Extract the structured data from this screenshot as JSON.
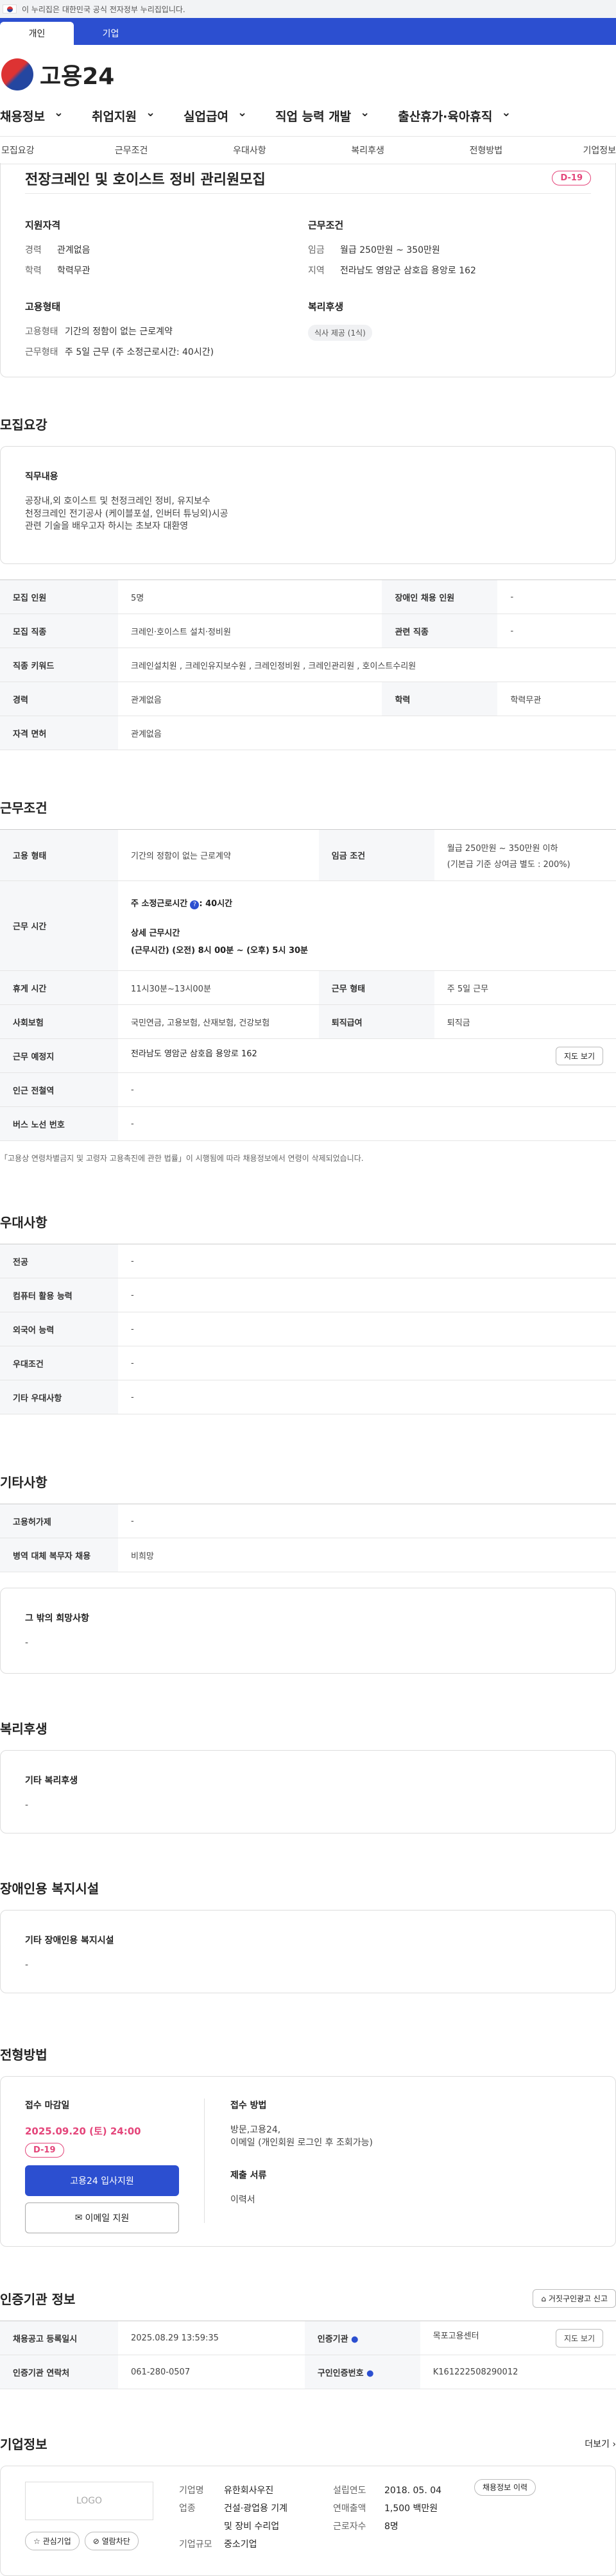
{
  "topbar": {
    "notice": "이 누리집은 대한민국 공식 전자정부 누리집입니다."
  },
  "tabs": [
    "개인",
    "기업"
  ],
  "brand": "고용24",
  "gnb": [
    "채용정보",
    "취업지원",
    "실업급여",
    "직업 능력 개발",
    "출산휴가·육아휴직"
  ],
  "subnav": [
    "모집요강",
    "근무조건",
    "우대사항",
    "복리후생",
    "전형방법",
    "기업정보"
  ],
  "job": {
    "title": "전장크레인 및 호이스트 정비 관리원모집",
    "dday": "D-19",
    "qual_title": "지원자격",
    "career_k": "경력",
    "career_v": "관계없음",
    "edu_k": "학력",
    "edu_v": "학력무관",
    "work_title": "근무조건",
    "wage_k": "임금",
    "wage_v": "월급 250만원 ~ 350만원",
    "loc_k": "지역",
    "loc_v": "전라남도 영암군 삼호읍 용앙로 162",
    "emp_title": "고용형태",
    "emp_k": "고용형태",
    "emp_v": "기간의 정함이 없는 근로계약",
    "type_k": "근무형태",
    "type_v": "주 5일 근무 (주 소정근로시간: 40시간)",
    "wel_title": "복리후생",
    "wel_chip": "식사 제공 (1식)"
  },
  "recruit": {
    "title": "모집요강",
    "duty_h": "직무내용",
    "duty_1": "공장내,외 호이스트 및 천정크레인 정비, 유지보수",
    "duty_2": "천정크레인 전기공사 (케이블포설, 인버터 튜닝외)시공",
    "duty_3": "관련 기술을 배우고자 하시는 초보자 대환영",
    "rows": [
      [
        "모집 인원",
        "5명",
        "장애인 채용 인원",
        "-"
      ],
      [
        "모집 직종",
        "크레인·호이스트 설치·정비원",
        "관련 직종",
        "-"
      ],
      [
        "직종 키워드",
        "크레인설치원 , 크레인유지보수원 , 크레인정비원 , 크레인관리원 , 호이스트수리원",
        "",
        ""
      ],
      [
        "경력",
        "관계없음",
        "학력",
        "학력무관"
      ],
      [
        "자격 면허",
        "관계없음",
        "",
        ""
      ]
    ]
  },
  "cond": {
    "title": "근무조건",
    "emp_h": "고용 형태",
    "emp_v": "기간의 정함이 없는 근로계약",
    "wage_h": "임금 조건",
    "wage_v1": "월급 250만원 ~ 350만원 이하",
    "wage_v2": "(기본급 기준 상여금 별도 : 200%)",
    "time_h": "근무 시간",
    "time_1": "주 소정근로시간",
    "time_1b": ": 40시간",
    "time_2": "상세 근무시간",
    "time_3": "(근무시간) (오전) 8시 00분 ~ (오후) 5시 30분",
    "rest_h": "휴게 시간",
    "rest_v": "11시30분~13시00분",
    "type_h": "근무 형태",
    "type_v": "주 5일 근무",
    "ins_h": "사회보험",
    "ins_v": "국민연금, 고용보험, 산재보험, 건강보험",
    "ret_h": "퇴직급여",
    "ret_v": "퇴직금",
    "loc_h": "근무 예정지",
    "loc_v": "전라남도 영암군 삼호읍 용앙로 162",
    "map_btn": "지도 보기",
    "sub_h": "인근 전철역",
    "sub_v": "-",
    "bus_h": "버스 노선 번호",
    "bus_v": "-",
    "note": "「고용상 연령차별금지 및 고령자 고용촉진에 관한 법률」이 시행됨에 따라 채용정보에서 연령이 삭제되었습니다."
  },
  "pref": {
    "title": "우대사항",
    "rows": [
      [
        "전공",
        "-"
      ],
      [
        "컴퓨터 활용 능력",
        "-"
      ],
      [
        "외국어 능력",
        "-"
      ],
      [
        "우대조건",
        "-"
      ],
      [
        "기타 우대사항",
        "-"
      ]
    ]
  },
  "etc": {
    "title": "기타사항",
    "rows": [
      [
        "고용허가제",
        "-"
      ],
      [
        "병역 대체 복무자 채용",
        "비희망"
      ]
    ],
    "wish_h": "그 밖의 희망사항",
    "wish_v": "-"
  },
  "welfare": {
    "title": "복리후생",
    "h": "기타 복리후생",
    "v": "-"
  },
  "dis": {
    "title": "장애인용 복지시설",
    "h": "기타 장애인용 복지시설",
    "v": "-"
  },
  "sel": {
    "title": "전형방법",
    "deadline_h": "접수 마감일",
    "deadline_v": "2025.09.20 (토) 24:00",
    "dday": "D-19",
    "apply_btn": "고용24 입사지원",
    "email_btn": "이메일 지원",
    "method_h": "접수 방법",
    "method_1": "방문,고용24,",
    "method_2": "이메일 (개인회원 로그인 후 조회가능)",
    "doc_h": "제출 서류",
    "doc_v": "이력서"
  },
  "cert": {
    "title": "인증기관 정보",
    "report_btn": "거짓구인광고 신고",
    "r1": [
      "채용공고 등록일시",
      "2025.08.29 13:59:35",
      "인증기관",
      "목포고용센터"
    ],
    "map_btn": "지도 보기",
    "r2": [
      "인증기관 연락처",
      "061-280-0507",
      "구인인증번호",
      "K161222508290012"
    ]
  },
  "comp": {
    "title": "기업정보",
    "more": "더보기",
    "logo": "LOGO",
    "fav": "관심기업",
    "block": "열람차단",
    "name_h": "기업명",
    "name_v": "유한회사우진",
    "ind_h": "업종",
    "ind_v1": "건설·광업용 기계",
    "ind_v2": "및 장비 수리업",
    "size_h": "기업규모",
    "size_v": "중소기업",
    "est_h": "설립연도",
    "est_v": "2018. 05. 04",
    "sales_h": "연매출액",
    "sales_v": "1,500 백만원",
    "emp_h": "근로자수",
    "emp_v": "8명",
    "info_btn": "채용정보 이력"
  }
}
